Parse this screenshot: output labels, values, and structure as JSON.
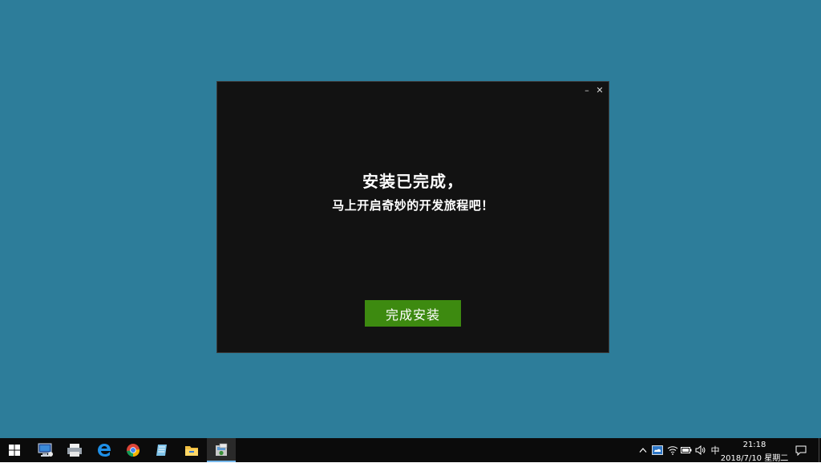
{
  "dialog": {
    "minimize_glyph": "–",
    "close_glyph": "✕",
    "heading": "安装已完成，",
    "subheading": "马上开启奇妙的开发旅程吧！",
    "finish_button": "完成安装",
    "accent_color": "#3d8a10"
  },
  "taskbar": {
    "pinned": [
      {
        "icon": "windows-start-icon"
      },
      {
        "icon": "this-pc-icon"
      },
      {
        "icon": "network-printer-icon"
      },
      {
        "icon": "edge-browser-icon"
      },
      {
        "icon": "chrome-browser-icon"
      },
      {
        "icon": "notepad-app-icon"
      },
      {
        "icon": "file-explorer-icon"
      },
      {
        "icon": "installer-app-icon",
        "active": true
      }
    ],
    "tray": {
      "chevron_glyph": "^",
      "ime": "中",
      "time": "21:18",
      "date": "2018/7/10 星期二"
    }
  }
}
